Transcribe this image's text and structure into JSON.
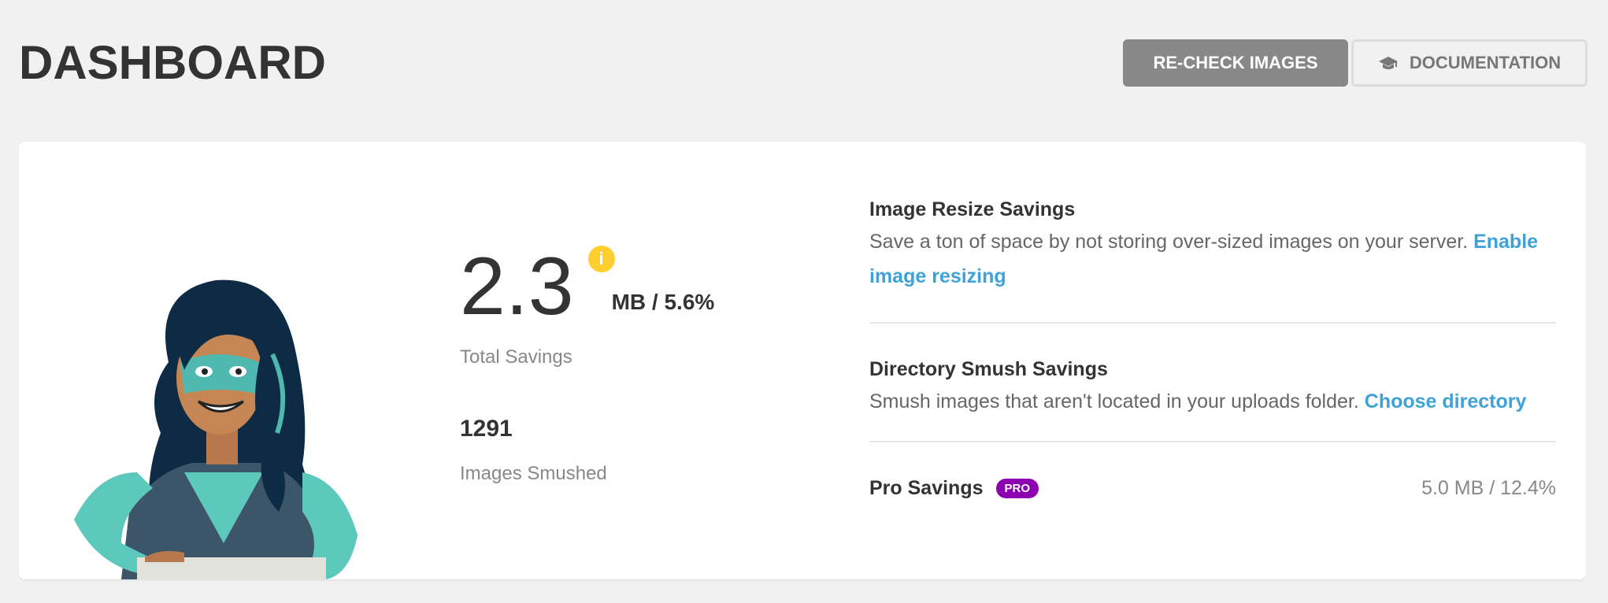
{
  "header": {
    "title": "DASHBOARD",
    "recheck_label": "RE-CHECK IMAGES",
    "docs_label": "DOCUMENTATION"
  },
  "summary": {
    "total_savings_value": "2.3",
    "total_savings_unit": "MB / 5.6%",
    "total_savings_label": "Total Savings",
    "info_icon": "i",
    "images_smushed_count": "1291",
    "images_smushed_label": "Images Smushed"
  },
  "details": {
    "resize": {
      "title": "Image Resize Savings",
      "description": "Save a ton of space by not storing over-sized images on your server.",
      "link": "Enable image resizing"
    },
    "directory": {
      "title": "Directory Smush Savings",
      "description": "Smush images that aren't located in your uploads folder.",
      "link": "Choose directory"
    },
    "pro": {
      "title": "Pro Savings",
      "badge": "PRO",
      "value": "5.0 MB / 12.4%"
    }
  },
  "colors": {
    "accent_link": "#3ea2d8",
    "pro_badge": "#8d00b1",
    "info_icon": "#fecf2f",
    "primary_button": "#888888"
  },
  "icons": {
    "docs": "graduation-cap-icon",
    "info": "info-icon"
  }
}
